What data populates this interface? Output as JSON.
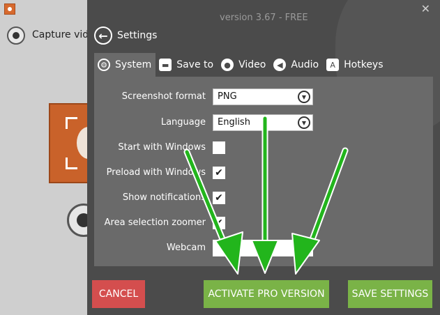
{
  "background_app": {
    "capture_label": "Capture video"
  },
  "header": {
    "version": "version 3.67  -  FREE",
    "close_glyph": "✕",
    "back_glyph": "←",
    "title": "Settings"
  },
  "tabs": [
    {
      "label": "System",
      "icon": "gears-icon",
      "active": true
    },
    {
      "label": "Save to",
      "icon": "folder-icon",
      "active": false
    },
    {
      "label": "Video",
      "icon": "record-icon",
      "active": false
    },
    {
      "label": "Audio",
      "icon": "speaker-icon",
      "active": false
    },
    {
      "label": "Hotkeys",
      "icon": "keyboard-icon",
      "active": false
    }
  ],
  "system": {
    "screenshot_format": {
      "label": "Screenshot format",
      "value": "PNG"
    },
    "language": {
      "label": "Language",
      "value": "English"
    },
    "start_with_windows": {
      "label": "Start with Windows",
      "checked": false
    },
    "preload_with_windows": {
      "label": "Preload with Windows",
      "checked": true
    },
    "show_notifications": {
      "label": "Show notifications",
      "checked": true
    },
    "area_selection_zoomer": {
      "label": "Area selection zoomer",
      "checked": true
    },
    "webcam": {
      "label": "Webcam",
      "value": ""
    }
  },
  "check_glyph": "✔",
  "buttons": {
    "cancel": "CANCEL",
    "activate": "ACTIVATE PRO VERSION",
    "save": "SAVE SETTINGS"
  },
  "colors": {
    "panel_bg": "#4b4b4b",
    "content_bg": "#6a6a6a",
    "cancel": "#d44e4e",
    "accent_green": "#7ab347",
    "arrow_green": "#22b51c"
  }
}
